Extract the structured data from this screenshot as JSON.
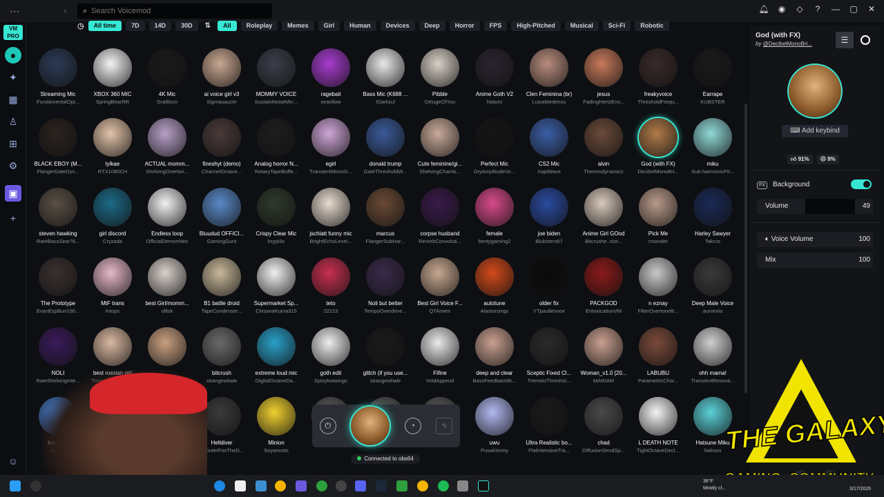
{
  "titlebar": {
    "search_placeholder": "Search Voicemod"
  },
  "filters": [
    "All time",
    "7D",
    "14D",
    "30D",
    "All",
    "Roleplay",
    "Memes",
    "Girl",
    "Human",
    "Devices",
    "Deep",
    "Horror",
    "FPS",
    "High-Pitched",
    "Musical",
    "Sci-Fi",
    "Robotic"
  ],
  "active_filters": [
    "All time",
    "All"
  ],
  "colors": {
    "accent": "#36e7d3",
    "panel": "#121418",
    "bg": "#0d0f12"
  },
  "voices": [
    [
      "Streaming Mic",
      "FundamentalOpt...",
      "#2b3a55"
    ],
    [
      "XBOX 360 MIC",
      "SpringBearRR",
      "#f4f4f4"
    ],
    [
      "4K Mic",
      "Grafiloco",
      "#1a1a1a"
    ],
    [
      "ai voice girl v3",
      "Sigmasaucer",
      "#c9a891"
    ],
    [
      "MOMMY VOICE",
      "SustainNoiseMin...",
      "#3b3f4a"
    ],
    [
      "ragebait",
      "seanllow",
      "#a83ccf"
    ],
    [
      "Bass Mic (K688 ...",
      "IDarksul",
      "#e9e9e9"
    ],
    [
      "Pibble",
      "DelugeOfYou",
      "#d9d0c7"
    ],
    [
      "Anime Goth V2",
      "Naturo",
      "#2b2430"
    ],
    [
      "Clen Feminina (br)",
      "LuizaMedeiros",
      "#b98d7e"
    ],
    [
      "jesus",
      "FadingHertzEnv...",
      "#c77a5a"
    ],
    [
      "freakyvoice",
      "ThresholdFrequ...",
      "#3a2a2a"
    ],
    [
      "Earrape",
      "KUBSTER",
      "#1a1a1a"
    ],
    [
      "BLACK EBOY (M...",
      "FlangerGateDyn...",
      "#2a221e"
    ],
    [
      "lylkae",
      "RTX1080CH",
      "#e3c3a9"
    ],
    [
      "ACTUAL momm...",
      "ShelvingOverton...",
      "#b8a0c8"
    ],
    [
      "fineshyt (demo)",
      "ChannelOctave...",
      "#4a3a38"
    ],
    [
      "Analog horror N...",
      "RotaryTapeBuffe...",
      "#1d1d1d"
    ],
    [
      "egirl",
      "TransientMonoG...",
      "#cfa6d8"
    ],
    [
      "donald trump",
      "GateThresholdW...",
      "#3a5a99"
    ],
    [
      "Cute feminine/gi...",
      "ShelvingChamb...",
      "#c9aa9a"
    ],
    [
      "Perfect Mic",
      "DryAmplitudeVo...",
      "#151515"
    ],
    [
      "CS2 Mic",
      "XapiWave",
      "#3b5ea5"
    ],
    [
      "alvin",
      "Thermodynamicz",
      "#6b4a3a"
    ],
    [
      "God (with FX)",
      "DecibelMonoBri...",
      "#b07a48"
    ],
    [
      "miku",
      "Sub-harmonicPit...",
      "#8fd9d6"
    ],
    [
      "steven hawking",
      "RateBassSine76...",
      "#5a5045"
    ],
    [
      "girl discord",
      "Cryzada",
      "#1c6a86"
    ],
    [
      "Endless loop",
      "OfficialDemonNeo",
      "#f2f2f2"
    ],
    [
      "Bluudud OFFICI...",
      "GamingGunt",
      "#5a8ac8"
    ],
    [
      "Crispy Clear Mic",
      "krypt3x",
      "#2f3a2b"
    ],
    [
      "jschlatt funny mic",
      "BrightEchoLevel...",
      "#e8dcd0"
    ],
    [
      "marcus",
      "FlangerSubHar...",
      "#6a4a35"
    ],
    [
      "corpse husband",
      "ReverbConvoluti...",
      "#3a1a4a"
    ],
    [
      "female",
      "bentygaming2",
      "#d94b8a"
    ],
    [
      "joe biden",
      "Blubsters67",
      "#2a4aa0"
    ],
    [
      "Anime Girl GOod",
      "Bitcrushe..nior...",
      "#d9c9bb"
    ],
    [
      "Pick Me",
      "rrsonder",
      "#b99a8a"
    ],
    [
      "Harley Sawyer",
      "Takrus",
      "#1a2a55"
    ],
    [
      "The Prototype",
      "EvanEspBun100...",
      "#3a3030"
    ],
    [
      "MtF trans",
      "Intops",
      "#e6b8c8"
    ],
    [
      "best Girl/momm...",
      "ollisk",
      "#d9d0cb"
    ],
    [
      "B1 battle droid",
      "TapeCondenser...",
      "#c9b89a"
    ],
    [
      "Supermarket Sp...",
      "ChisanaKuma315",
      "#f0f0f0"
    ],
    [
      "teto",
      "22223",
      "#c83050"
    ],
    [
      "Noli but better",
      "TempoOverdrive...",
      "#3a2a4a"
    ],
    [
      "Best Girl Voice F...",
      "QTArwen",
      "#c8a890"
    ],
    [
      "autotune",
      "Alastorsings",
      "#d24a1a"
    ],
    [
      "older fix",
      "YTpaullennox",
      "#0a0a0a"
    ],
    [
      "PACKGOD",
      "EntoxicationVM",
      "#8a1a1a"
    ],
    [
      "n eznay",
      "FilterOvertoneB...",
      "#c9c9c9"
    ],
    [
      "Deep Male Voice",
      "aurvexia",
      "#3a3a3a"
    ],
    [
      "NOLI",
      "RateShelvingInte...",
      "#3a1a5a"
    ],
    [
      "best russian girl",
      "TremoloEchoPar...",
      "#d9b8a0"
    ],
    [
      "",
      "",
      "#c9a080"
    ],
    [
      "bitcrush",
      "strangewhale",
      "#6a6a6a"
    ],
    [
      "extreme loud mic",
      "DigitalOctaveDa...",
      "#2aa0c8"
    ],
    [
      "goth edit",
      "Spizyhotwings",
      "#eeeeee"
    ],
    [
      "glitch (if you use...",
      "strangewhale",
      "#1a1a1a"
    ],
    [
      "Fifine",
      "VoidAppend",
      "#eaeaea"
    ],
    [
      "deep and clear",
      "BassFeedbackBr...",
      "#c9a090"
    ],
    [
      "Sceptic Fixed Cl...",
      "TremoloThreshol...",
      "#2a2a2a"
    ],
    [
      "Woman_v1.0 [20...",
      "MARIAM",
      "#c9a090"
    ],
    [
      "LABUBU",
      "ParametricChor...",
      "#7a4a3a"
    ],
    [
      "ohh mama!",
      "TransientResona...",
      "#d0d0d0"
    ],
    [
      "low qu...",
      "Bob...",
      "#4a7ac8"
    ],
    [
      "",
      "",
      "#2a2a2a"
    ],
    [
      "",
      "",
      "#c9a080"
    ],
    [
      "Helldiver",
      "DabuterFoxTheD...",
      "#3a3a3a"
    ],
    [
      "Minion",
      "Soyanoots",
      "#f0d030"
    ],
    [
      "",
      "",
      "#5a5a5a"
    ],
    [
      "",
      "",
      "#5a5a5a"
    ],
    [
      "",
      "",
      "#5a5a5a"
    ],
    [
      "uwu",
      "PusaKimmy",
      "#b0b8f0"
    ],
    [
      "Ultra Realistic bo...",
      "FlatIntensiveTra...",
      "#1a1a1a"
    ],
    [
      "chad",
      "DiffusionSendSp...",
      "#4a4a4a"
    ],
    [
      "L DEATH NOTE",
      "TightOctaveDecl...",
      "#f4f4f4"
    ],
    [
      "Hatsune Miku",
      "Nahuro",
      "#5ad0d6"
    ]
  ],
  "panel": {
    "title": "God (with FX)",
    "by_prefix": "by ",
    "author": "@DecibelMonoBri...",
    "keybind": "Add keybind",
    "like_pct": "91%",
    "dislike_pct": "9%",
    "background_label": "Background",
    "volume_label": "Volume",
    "volume_value": "49",
    "voice_volume_label": "Voice Volume",
    "voice_volume_value": "100",
    "mix_label": "Mix",
    "mix_value": "100"
  },
  "dock": {
    "status": "Connected to obs64"
  },
  "overlay": {
    "title": "THE GALAXY",
    "subtitle": "GAMING. COMMUNITY"
  },
  "tray": {
    "weather": "36°F",
    "weather_desc": "Mostly cl...",
    "date": "3/17/2026"
  }
}
